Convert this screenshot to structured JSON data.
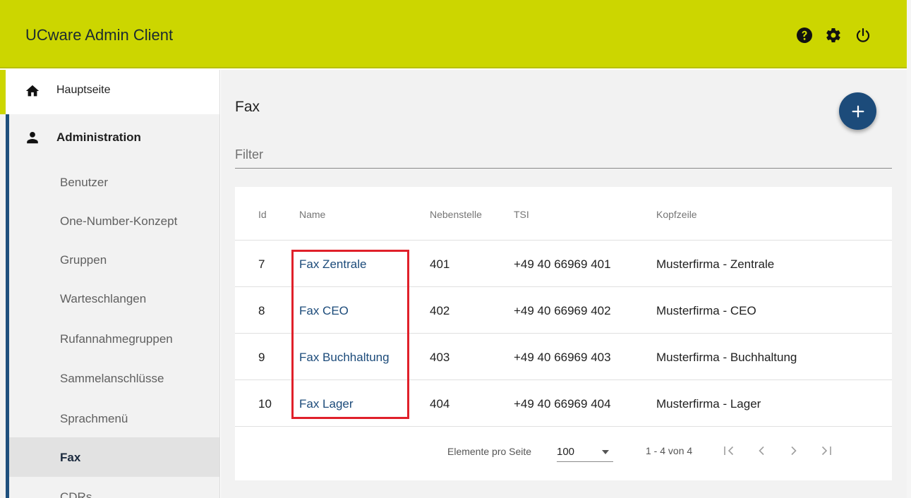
{
  "header": {
    "title": "UCware Admin Client",
    "icons": [
      "help-icon",
      "gear-icon",
      "power-icon"
    ],
    "background": "#ccd600"
  },
  "sidebar": {
    "home_label": "Hauptseite",
    "admin_label": "Administration",
    "items": [
      {
        "label": "Benutzer"
      },
      {
        "label": "One-Number-Konzept"
      },
      {
        "label": "Gruppen"
      },
      {
        "label": "Warteschlangen"
      },
      {
        "label": "Rufannahmegruppen"
      },
      {
        "label": "Sammelanschlüsse"
      },
      {
        "label": "Sprachmenü"
      },
      {
        "label": "Fax",
        "active": true
      },
      {
        "label": "CDRs"
      }
    ],
    "accent_color": "#1e4f7d"
  },
  "main": {
    "title": "Fax",
    "filter_placeholder": "Filter",
    "fab_icon": "plus-icon",
    "table": {
      "columns": [
        "Id",
        "Name",
        "Nebenstelle",
        "TSI",
        "Kopfzeile"
      ],
      "rows": [
        {
          "id": "7",
          "name": "Fax Zentrale",
          "ext": "401",
          "tsi": "+49 40 66969 401",
          "header": "Musterfirma - Zentrale"
        },
        {
          "id": "8",
          "name": "Fax CEO",
          "ext": "402",
          "tsi": "+49 40 66969 402",
          "header": "Musterfirma - CEO"
        },
        {
          "id": "9",
          "name": "Fax Buchhaltung",
          "ext": "403",
          "tsi": "+49 40 66969 403",
          "header": "Musterfirma - Buchhaltung"
        },
        {
          "id": "10",
          "name": "Fax Lager",
          "ext": "404",
          "tsi": "+49 40 66969 404",
          "header": "Musterfirma - Lager"
        }
      ]
    },
    "paginator": {
      "items_per_page_label": "Elemente pro Seite",
      "page_size": "100",
      "range_label": "1 - 4 von 4"
    },
    "link_color": "#1c4b7a",
    "highlight_color": "#e0202a"
  }
}
